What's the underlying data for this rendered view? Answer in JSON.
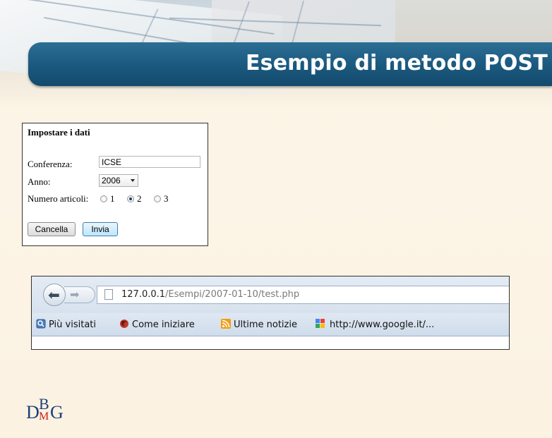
{
  "slide": {
    "title": "Esempio di metodo POST"
  },
  "form": {
    "heading": "Impostare i dati",
    "conferenza_label": "Conferenza:",
    "conferenza_value": "ICSE",
    "anno_label": "Anno:",
    "anno_selected": "2006",
    "numero_label": "Numero articoli:",
    "radio_options": [
      "1",
      "2",
      "3"
    ],
    "radio_selected": "2",
    "cancel_label": "Cancella",
    "submit_label": "Invia"
  },
  "browser": {
    "url_host": "127.0.0.1",
    "url_path": "/Esempi/2007-01-10/test.php",
    "bookmarks": [
      "Più visitati",
      "Come iniziare",
      "Ultime notizie",
      "http://www.google.it/..."
    ]
  },
  "logo": {
    "d": "D",
    "b": "B",
    "m": "M",
    "g": "G"
  },
  "colors": {
    "title_bar": "#1c5a80",
    "background": "#fcf4e6",
    "logo_blue": "#1b3f7a",
    "logo_red": "#c8201e"
  }
}
